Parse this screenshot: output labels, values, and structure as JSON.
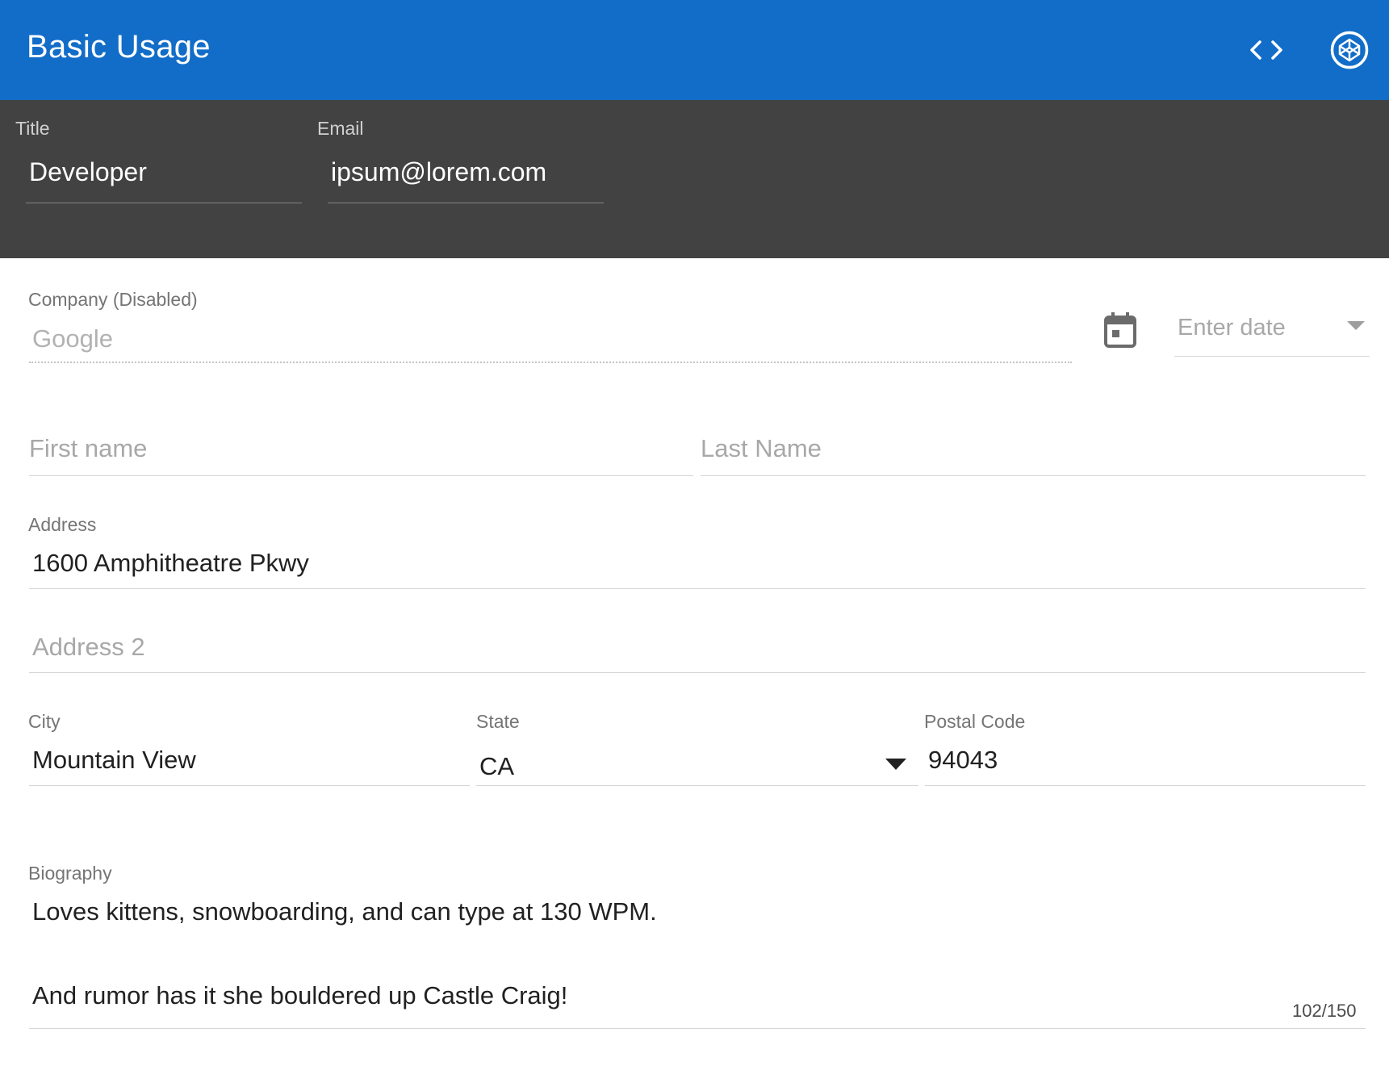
{
  "toolbar": {
    "title": "Basic Usage",
    "code_icon": "code-brackets-icon",
    "codepen_icon": "codepen-icon",
    "background_color": "#126dc8"
  },
  "dark_section": {
    "background_color": "#424242",
    "title": {
      "label": "Title",
      "value": "Developer"
    },
    "email": {
      "label": "Email",
      "value": "ipsum@lorem.com"
    }
  },
  "form": {
    "company": {
      "label": "Company (Disabled)",
      "value": "Google"
    },
    "date": {
      "icon": "calendar-icon",
      "placeholder": "Enter date",
      "dropdown_icon": "triangle-down-icon"
    },
    "first_name": {
      "placeholder": "First name"
    },
    "last_name": {
      "placeholder": "Last Name"
    },
    "address": {
      "label": "Address",
      "value": "1600 Amphitheatre Pkwy"
    },
    "address2": {
      "placeholder": "Address 2"
    },
    "city": {
      "label": "City",
      "value": "Mountain View"
    },
    "state": {
      "label": "State",
      "value": "CA"
    },
    "postal_code": {
      "label": "Postal Code",
      "value": "94043"
    },
    "biography": {
      "label": "Biography",
      "line1": "Loves kittens, snowboarding, and can type at 130 WPM.",
      "line2": "And rumor has it she bouldered up Castle Craig!",
      "counter": "102/150"
    }
  }
}
